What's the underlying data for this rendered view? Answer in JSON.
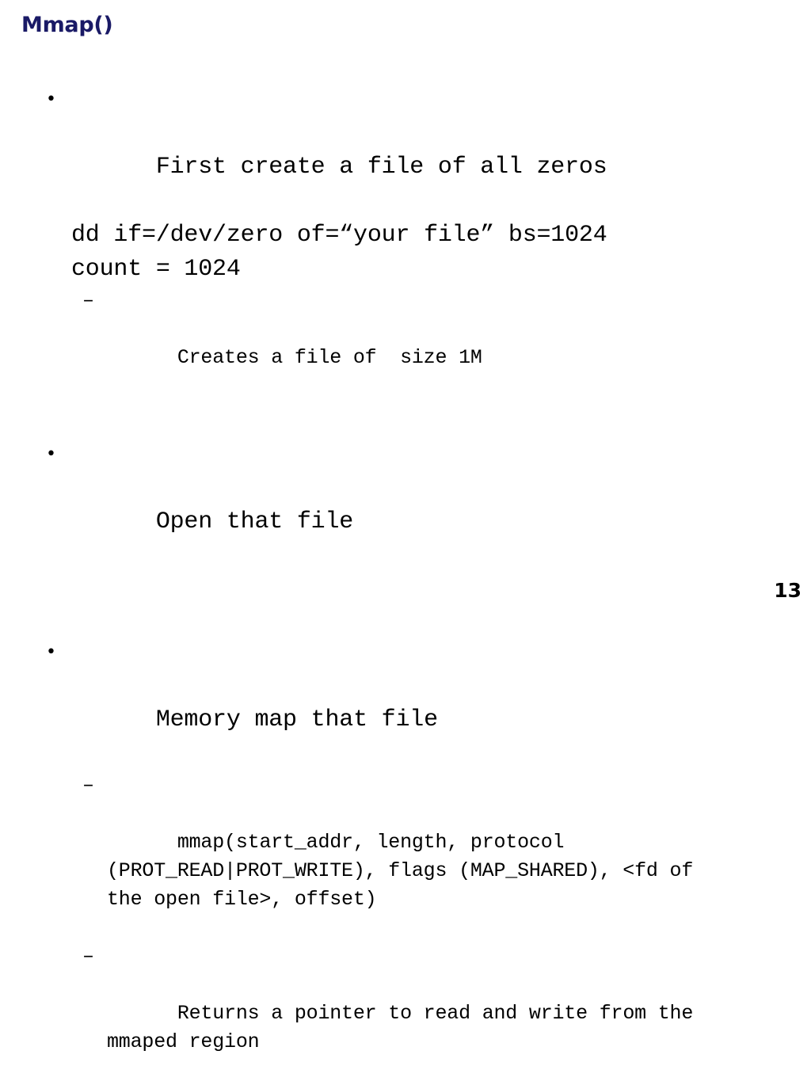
{
  "slide": {
    "title": "Mmap()",
    "page_number": "13",
    "title_color": "#1a1a66",
    "text_color": "#000000",
    "background_color": "#ffffff",
    "bullet_glyph": "•",
    "dash_glyph": "–",
    "bullets": [
      {
        "level": 1,
        "text": "First create a file of all zeros",
        "continuations": [
          "dd if=/dev/zero of=“your file” bs=1024",
          "count = 1024"
        ],
        "sub_bullets": [
          "Creates a file of  size 1M"
        ]
      },
      {
        "level": 1,
        "text": "Open that file",
        "continuations": [],
        "sub_bullets": []
      },
      {
        "level": 1,
        "text": "Memory map that file",
        "continuations": [],
        "sub_bullets": [
          "mmap(start_addr, length, protocol (PROT_READ|PROT_WRITE), flags (MAP_SHARED), <fd of the open file>, offset)",
          "Returns a pointer to read and write from the mmaped region"
        ]
      }
    ]
  }
}
